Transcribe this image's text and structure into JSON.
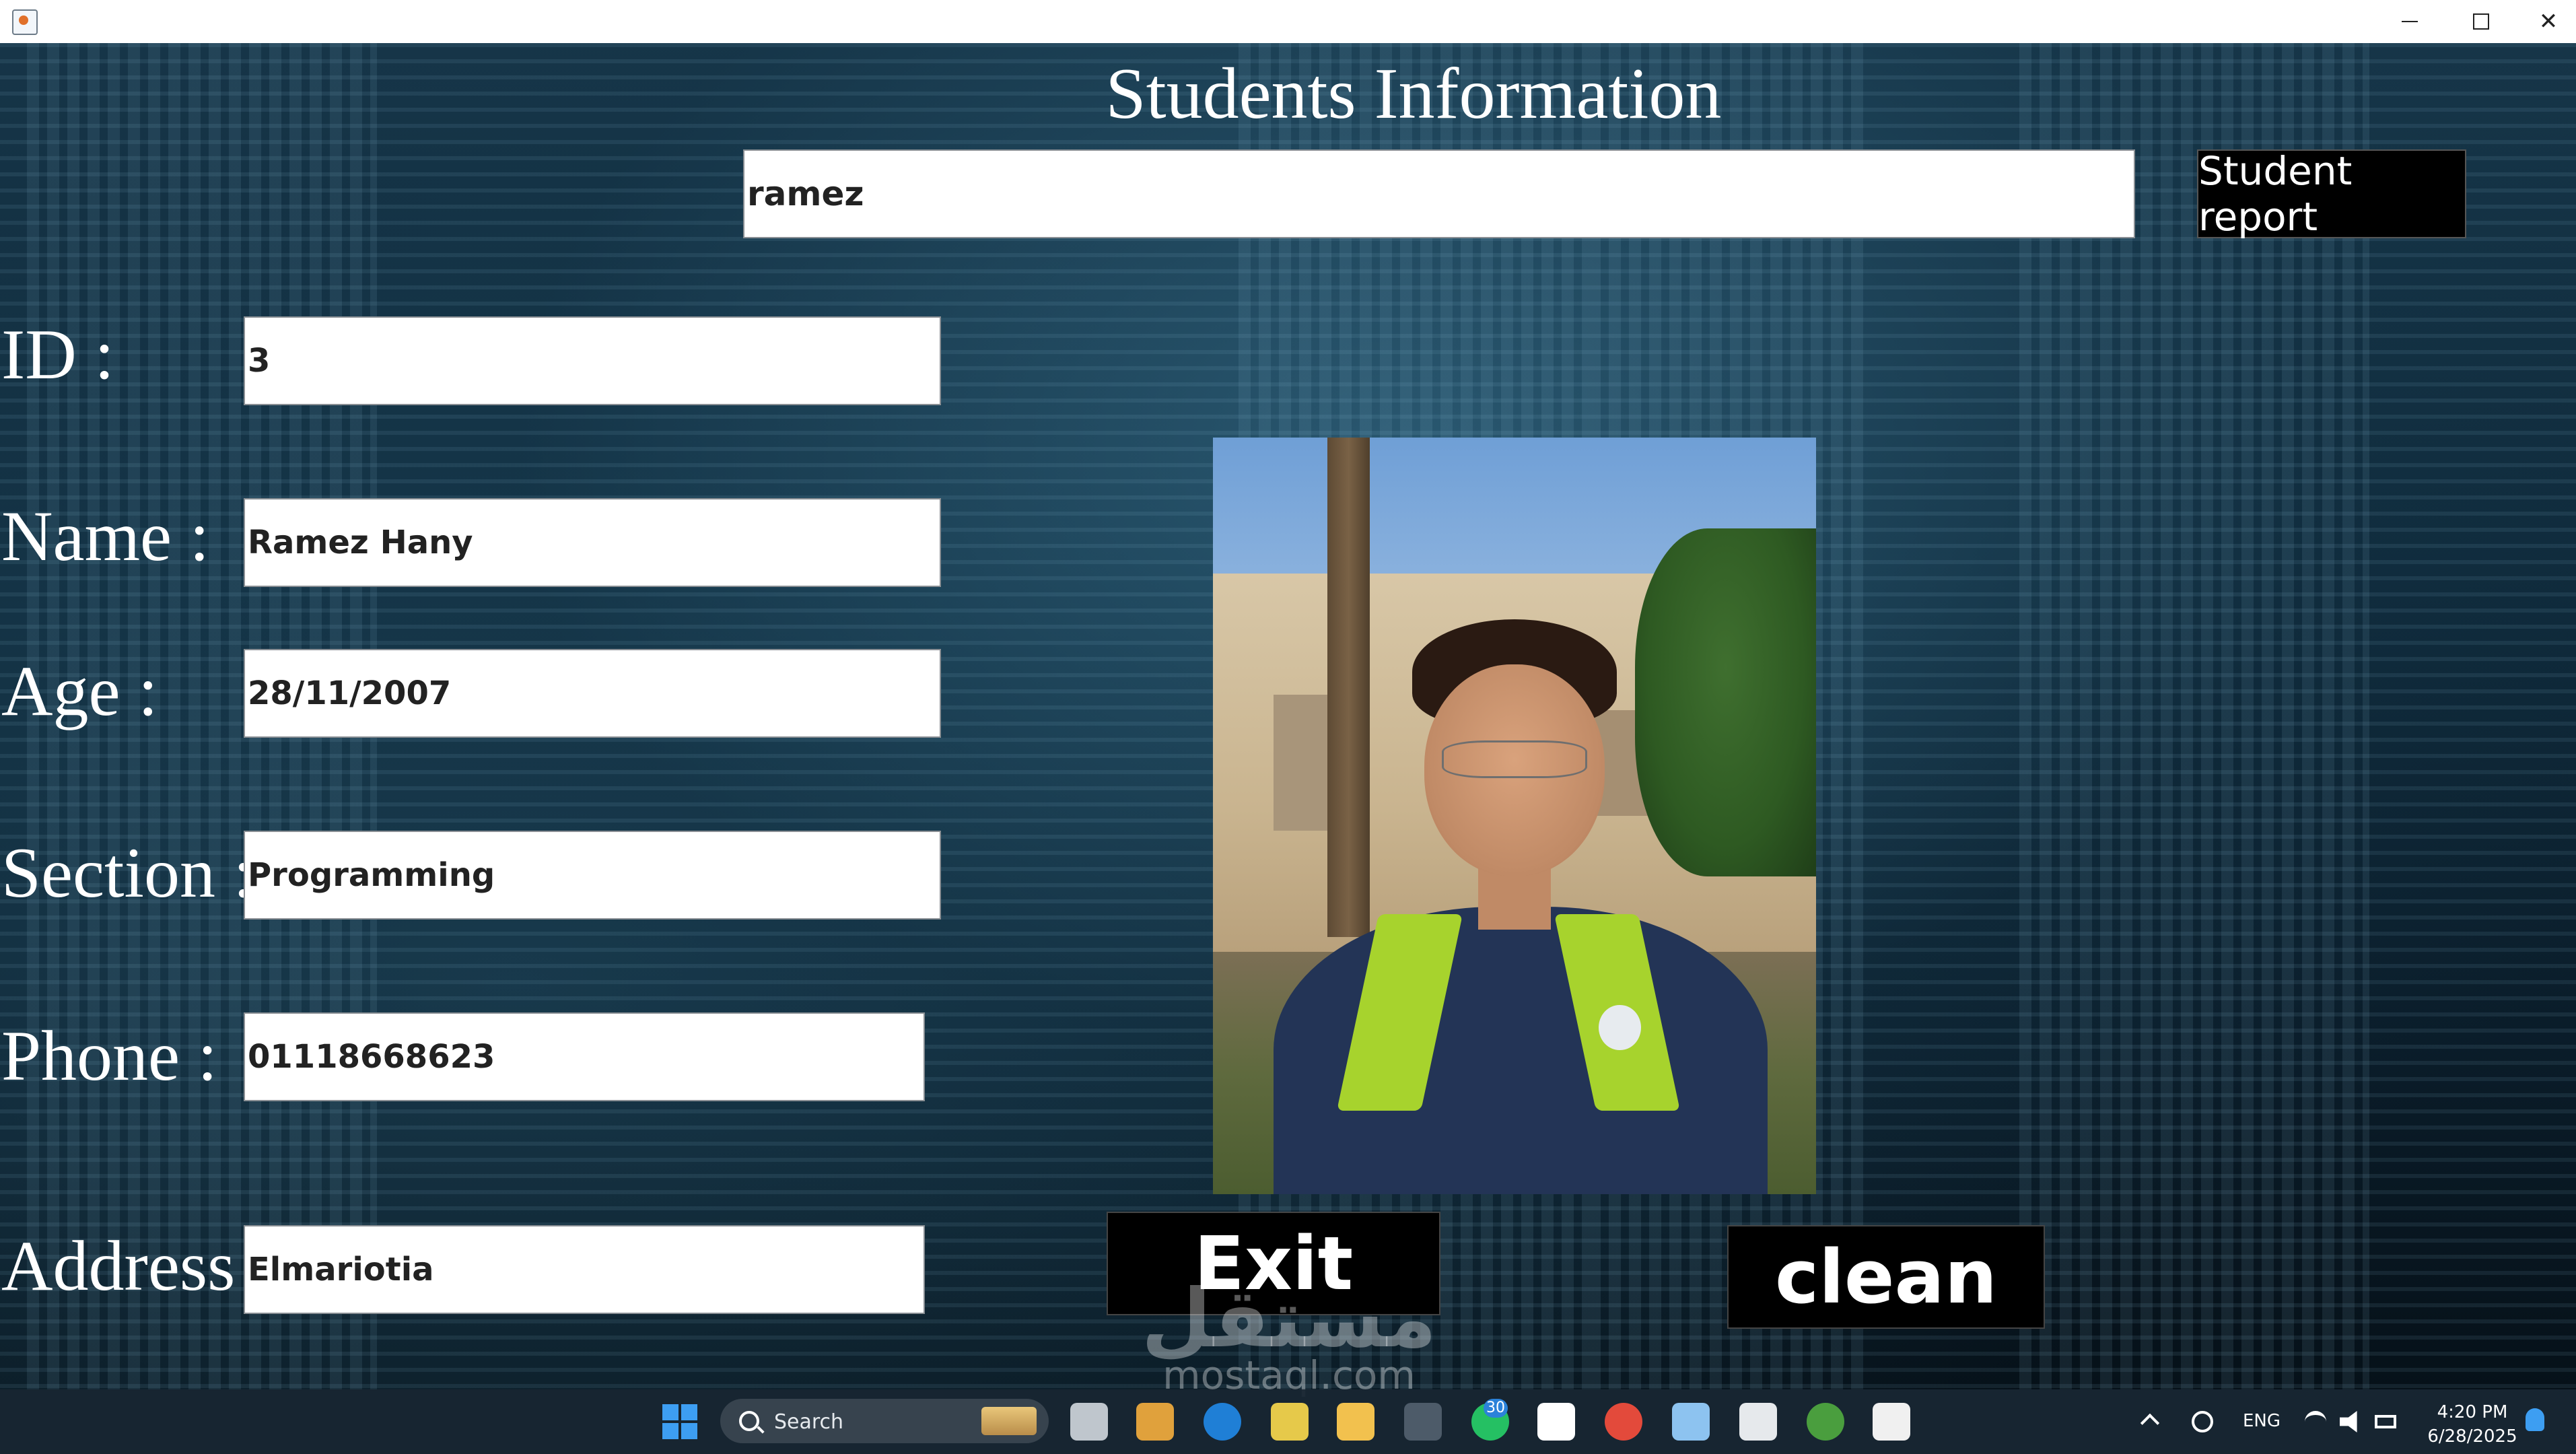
{
  "window": {
    "controls": {
      "minimize": "minimize-icon",
      "maximize": "maximize-icon",
      "close": "close-icon"
    }
  },
  "form": {
    "title": "Students Information",
    "search": {
      "value": "ramez"
    },
    "report_button": "Student report",
    "fields": [
      {
        "label": "ID :",
        "value": "3"
      },
      {
        "label": "Name :",
        "value": "Ramez Hany"
      },
      {
        "label": "Age :",
        "value": "28/11/2007"
      },
      {
        "label": "Section :",
        "value": "Programming"
      },
      {
        "label": "Phone :",
        "value": "01118668623"
      },
      {
        "label": "Address",
        "value": "Elmariotia"
      }
    ],
    "exit_button": "Exit",
    "clean_button": "clean"
  },
  "watermark": {
    "arabic": "مستقل",
    "latin": "mostaql.com"
  },
  "taskbar": {
    "search_label": "Search",
    "notification_count": "30",
    "language": "ENG",
    "time": "4:20 PM",
    "date": "6/28/2025"
  },
  "colors": {
    "accent": "#3d9ef2",
    "button_bg": "#000000",
    "background": "#0f2a3b"
  }
}
